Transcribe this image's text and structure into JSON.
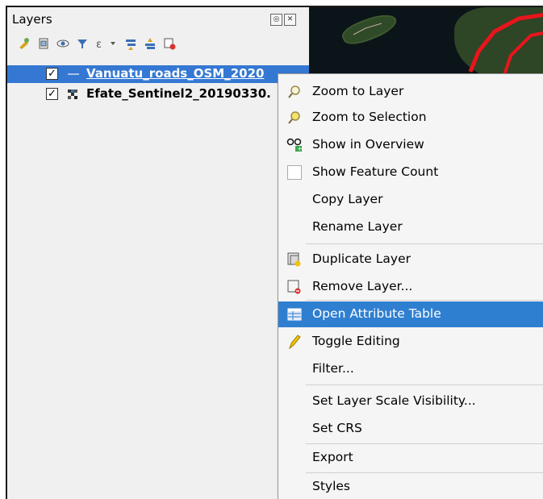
{
  "panel": {
    "title": "Layers",
    "window_buttons": [
      "◎",
      "✕"
    ]
  },
  "layers": [
    {
      "name": "Vanuatu_roads_OSM_2020",
      "checked": "✓",
      "selected": true
    },
    {
      "name": "Efate_Sentinel2_20190330.",
      "checked": "✓",
      "selected": false
    }
  ],
  "toolbar": {
    "icons": [
      "style-manager-icon",
      "add-group-icon",
      "visibility-icon",
      "filter-icon",
      "filter-expression-icon",
      "expand-all-icon",
      "collapse-all-icon",
      "remove-layer-icon"
    ]
  },
  "context_menu": {
    "items": [
      {
        "label": "Zoom to Layer",
        "icon": "zoom-layer-icon"
      },
      {
        "label": "Zoom to Selection",
        "icon": "zoom-selection-icon"
      },
      {
        "label": "Show in Overview",
        "icon": "overview-icon"
      },
      {
        "label": "Show Feature Count",
        "icon": "checkbox-icon"
      },
      {
        "label": "Copy Layer",
        "icon": ""
      },
      {
        "label": "Rename Layer",
        "icon": ""
      },
      {
        "label": "Duplicate Layer",
        "icon": "duplicate-icon"
      },
      {
        "label": "Remove Layer...",
        "icon": "remove-icon"
      },
      {
        "label": "Open Attribute Table",
        "icon": "table-icon",
        "highlighted": true
      },
      {
        "label": "Toggle Editing",
        "icon": "pencil-icon"
      },
      {
        "label": "Filter...",
        "icon": ""
      },
      {
        "label": "Set Layer Scale Visibility...",
        "icon": ""
      },
      {
        "label": "Set CRS",
        "icon": "",
        "submenu": "▸"
      },
      {
        "label": "Export",
        "icon": "",
        "submenu": "▸"
      },
      {
        "label": "Styles",
        "icon": "",
        "submenu": "▸"
      }
    ]
  },
  "colors": {
    "selection": "#3478d3",
    "menu_highlight": "#2f7fd1",
    "road_red": "#e8151b"
  }
}
